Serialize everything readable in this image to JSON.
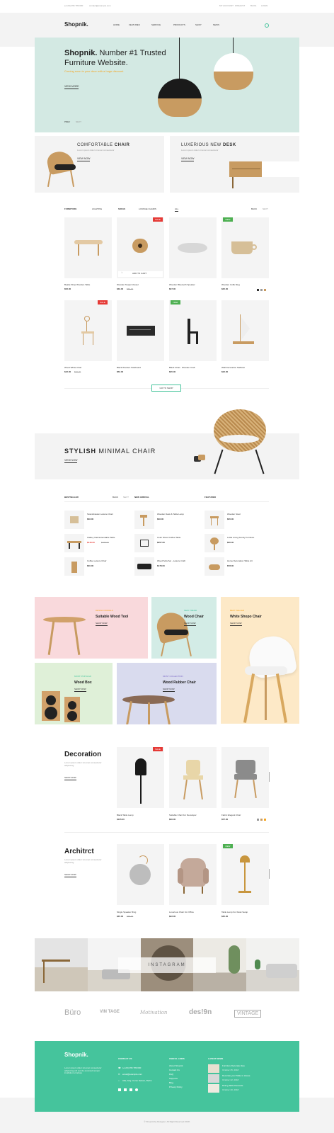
{
  "topbar": {
    "left": [
      "(+123) 456 789 090",
      "contact@example.com"
    ],
    "right": [
      "MY ACCOUNT",
      "WISHLIST",
      "BLOG",
      "LOGIN"
    ]
  },
  "header": {
    "logo": "Shopnik.",
    "nav": [
      "HOME",
      "FEATURES",
      "SERVICE",
      "PRODUCTS",
      "SHOP",
      "NEWS"
    ]
  },
  "hero": {
    "title_bold": "Shopnik.",
    "title_rest": " Number #1 Trusted",
    "title_line2": "Furniture Website.",
    "subtitle": "Coming soon in your door with a huge discount",
    "cta": "VIEW MORE",
    "pager": [
      "PREV",
      "NEXT"
    ]
  },
  "promo": [
    {
      "title_light": "COMFORTABLE ",
      "title_bold": "CHAIR",
      "desc": "Lorem ipsum dolor sit amet consectetur",
      "cta": "VIEW NOW"
    },
    {
      "title_light": "LUXERIOUS NEW ",
      "title_bold": "DESK",
      "desc": "Lorem ipsum dolor sit amet consectetur",
      "cta": "VIEW NOW"
    }
  ],
  "filters": {
    "tabs": [
      "FURNITURE",
      "LIGHTING",
      "SOFAS",
      "LOUNGE CHAIRS",
      "ALL"
    ],
    "pager": [
      "BACK",
      "NEXT"
    ]
  },
  "products": [
    {
      "name": "Beatle Shop Wooden Table",
      "price": "$52.00",
      "old": "",
      "badge": ""
    },
    {
      "name": "Wooden Teapot Vessel",
      "price": "$49.00",
      "old": "$59.00",
      "badge": "SALE",
      "add": "ADD TO CART"
    },
    {
      "name": "Wooden Bluetooth Speaker",
      "price": "$37.00",
      "old": "",
      "badge": ""
    },
    {
      "name": "Wooden Coffe Mug",
      "price": "$25.00",
      "old": "",
      "badge": "NEW"
    },
    {
      "name": "Wood White Chair",
      "price": "$42.00",
      "old": "$60.00",
      "badge": "SALE"
    },
    {
      "name": "Black Wooden Sideboard",
      "price": "$52.00",
      "old": "",
      "badge": ""
    },
    {
      "name": "Black Chair - Wooden Craft",
      "price": "$35.00",
      "old": "",
      "badge": "NEW"
    },
    {
      "name": "Wall Decoration Sailboat",
      "price": "$22.00",
      "old": "",
      "badge": ""
    }
  ],
  "go_to_shop": "GO TO SHOP",
  "banner": {
    "bold": "STYLISH",
    "light": " MINIMAL CHAIR",
    "cta": "VIEW NOW"
  },
  "lists": {
    "bestseller": {
      "title": "BESTSELLER",
      "pager": [
        "BACK",
        "NEXT"
      ],
      "items": [
        {
          "name": "Scandinavian Leisure Chair",
          "price": "$36.00",
          "old": ""
        },
        {
          "name": "Oakley Oak Extendable Table",
          "price": "$140.00",
          "old": "$160.00"
        },
        {
          "name": "Coffee Leisure Chair",
          "price": "$30.00",
          "old": ""
        }
      ]
    },
    "new_arrival": {
      "title": "NEW ARRIVAL",
      "items": [
        {
          "name": "Wooden Desk & Table Lamp",
          "price": "$36.00"
        },
        {
          "name": "Color Wood Coffee Table",
          "price": "$257.00"
        },
        {
          "name": "Wood Sofa Set - Leisure Craft",
          "price": "$178.00"
        }
      ]
    },
    "featured": {
      "title": "FEATURED",
      "items": [
        {
          "name": "Wooden Stool",
          "price": "$35.00"
        },
        {
          "name": "Lolita Living Family Furniture",
          "price": "$30.00"
        },
        {
          "name": "Home Decoration Table Art",
          "price": "$78.00"
        }
      ]
    }
  },
  "categories": [
    {
      "sub": "DESIGN MODELS",
      "title": "Suitable Wood Tool",
      "cta": "SHOP NOW",
      "bg": "#f9d9dc"
    },
    {
      "sub": "NEW TREND",
      "title": "Wood Chair",
      "cta": "SHOP NOW",
      "bg": "#d3ece6"
    },
    {
      "sub": "BEST SELLER",
      "title": "White Shopo Chair",
      "cta": "SHOP NOW",
      "bg": "#fde9c7"
    },
    {
      "sub": "MOST POPULAR",
      "title": "Wood Box",
      "cta": "SHOP NOW",
      "bg": "#dff0d8"
    },
    {
      "sub": "MOST COLLECTION",
      "title": "Wood Rubber Chair",
      "cta": "SHOP NOW",
      "bg": "#d9dbee"
    }
  ],
  "decoration": {
    "title": "Decoration",
    "desc": "Lorem ipsum dolor sit amet consectetur adipiscing",
    "cta": "SHOP NOW",
    "items": [
      {
        "name": "Black Table Lamp",
        "price": "$105.00",
        "badge": "SALE"
      },
      {
        "name": "Suitable Chair For Developer",
        "price": "$30.00",
        "badge": ""
      },
      {
        "name": "Fabric Elegant Chair",
        "price": "$57.00",
        "badge": ""
      }
    ]
  },
  "architect": {
    "title": "Architrct",
    "desc": "Lorem ipsum dolor sit amet consectetur adipiscing",
    "cta": "SHOP NOW",
    "items": [
      {
        "name": "Single Speaker Ring",
        "price": "$45.00",
        "old": "$55.00",
        "badge": ""
      },
      {
        "name": "Luxerious Chair For Office",
        "price": "$22.00",
        "badge": ""
      },
      {
        "name": "Table Lamp For Desk Setup",
        "price": "$35.00",
        "badge": "NEW"
      }
    ]
  },
  "instagram": "INSTAGRAM",
  "brands": [
    "Büro",
    "VIN TAGE",
    "Motivation",
    "des!9n",
    "VINTAGE"
  ],
  "footer": {
    "logo": "Shopnik.",
    "about": "Lorem ipsum dolor sit amet consectetur adipiscing elit sed do eiusmod tempor incididunt ut labore",
    "contact_title": "CONTACT US",
    "contact": [
      "(+123) 456 789 090",
      "email@example.com",
      "Alla, Grig. Corso Nelson, Berlin"
    ],
    "useful_title": "USEFUL LINKS",
    "useful": [
      "About Shopnik",
      "Contact Us",
      "FAQ",
      "Supports",
      "Blog",
      "Privacy Policy"
    ],
    "news_title": "LATEST NEWS",
    "news": [
      {
        "title": "Furniture Decorate Idea",
        "date": "October 25, 2018"
      },
      {
        "title": "Decorate your Table in House",
        "date": "October 22, 2018"
      },
      {
        "title": "Dining Table Decorate",
        "date": "October 20, 2018"
      }
    ],
    "copyright": "© Shopnik by Designer. All Right Reserved 2018."
  },
  "colors": {
    "accent": "#45c49c",
    "hero_bg": "#d3e9e3",
    "sale": "#e53935",
    "new": "#4caf50",
    "gold": "#f5a623"
  }
}
